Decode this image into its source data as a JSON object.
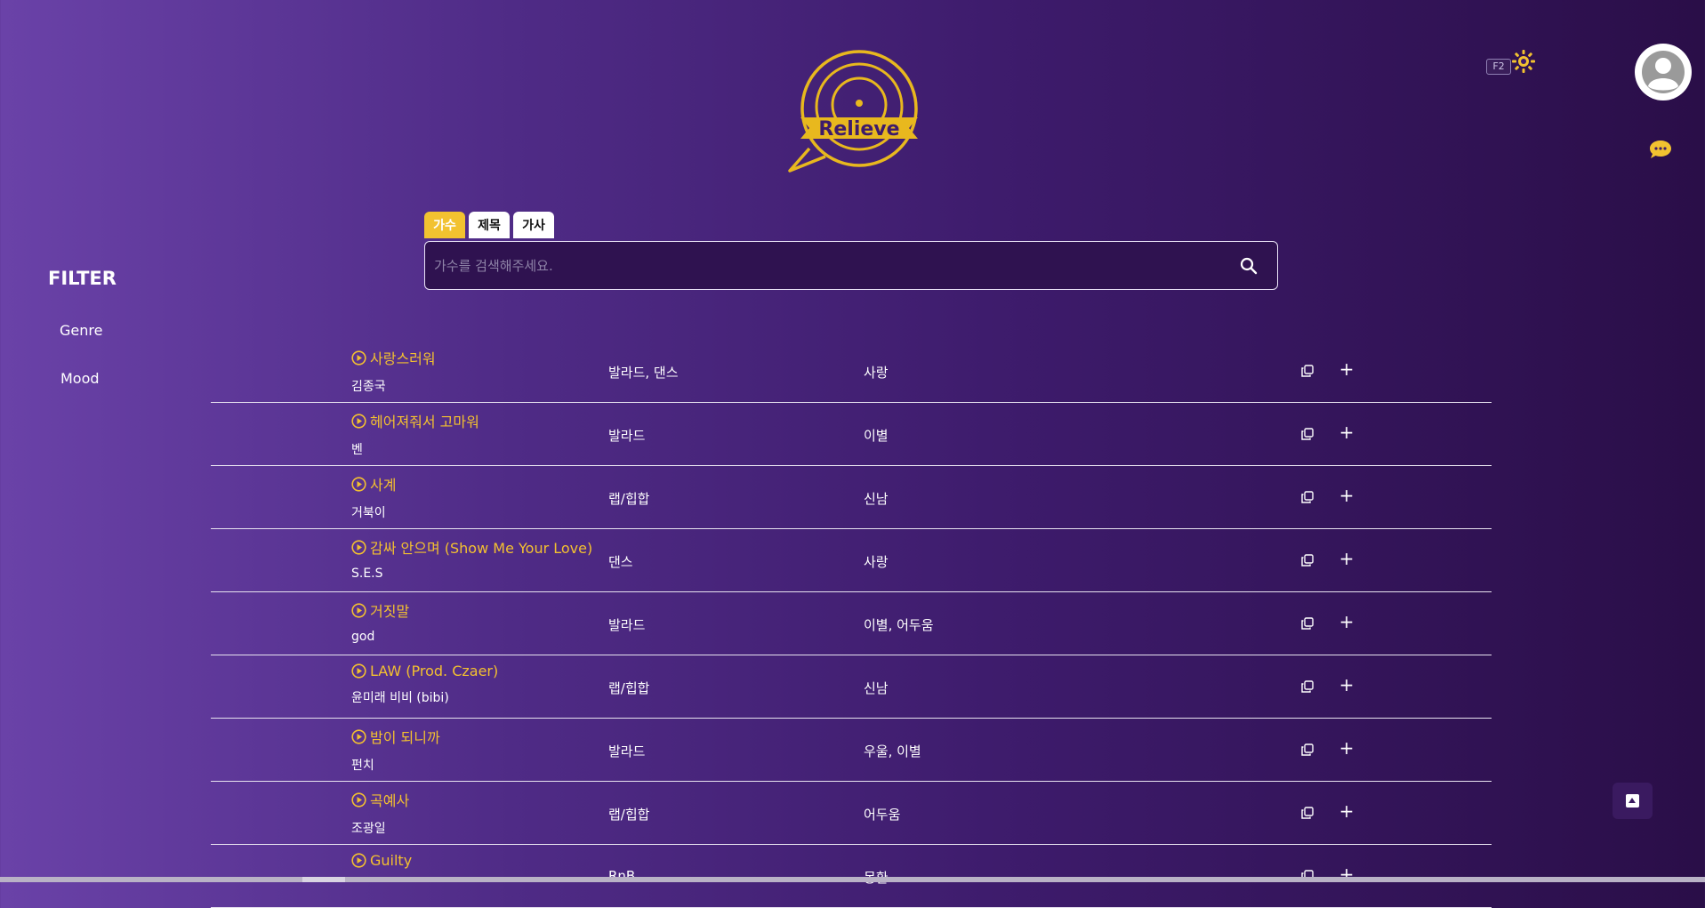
{
  "brand": {
    "logo_text": "Relieve",
    "accent": "#f2c230"
  },
  "header": {
    "shortcut_badge": "F2",
    "theme_icon": "sun-icon",
    "profile_icon": "user-icon",
    "chat_icon": "chat-icon"
  },
  "search": {
    "tabs": [
      {
        "label": "가수",
        "active": true
      },
      {
        "label": "제목",
        "active": false
      },
      {
        "label": "가사",
        "active": false
      }
    ],
    "placeholder": "가수를 검색해주세요.",
    "value": ""
  },
  "filter": {
    "title": "FILTER",
    "items": [
      "Genre",
      "Mood"
    ]
  },
  "songs": [
    {
      "title": "사랑스러워",
      "artist": "김종국",
      "genre": "발라드, 댄스",
      "mood": "사랑"
    },
    {
      "title": "헤어져줘서 고마워",
      "artist": "벤",
      "genre": "발라드",
      "mood": "이별"
    },
    {
      "title": "사계",
      "artist": "거북이",
      "genre": "랩/힙합",
      "mood": "신남"
    },
    {
      "title": "감싸 안으며 (Show Me Your Love)",
      "artist": "S.E.S",
      "genre": "댄스",
      "mood": "사랑"
    },
    {
      "title": "거짓말",
      "artist": "god",
      "genre": "발라드",
      "mood": "이별, 어두움"
    },
    {
      "title": "LAW (Prod. Czaer)",
      "artist": "윤미래 비비 (bibi)",
      "genre": "랩/힙합",
      "mood": "신남"
    },
    {
      "title": "밤이 되니까",
      "artist": "펀치",
      "genre": "발라드",
      "mood": "우울, 이별"
    },
    {
      "title": "곡예사",
      "artist": "조광일",
      "genre": "랩/힙합",
      "mood": "어두움"
    },
    {
      "title": "Guilty",
      "artist": "",
      "genre": "RnB",
      "mood": "몽환"
    }
  ],
  "row_icons": {
    "copy": "copy-icon",
    "add": "plus-icon"
  },
  "scroll_top_icon": "arrow-up-icon"
}
